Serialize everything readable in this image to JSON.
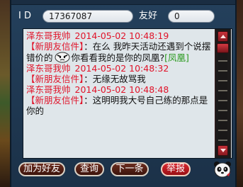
{
  "header": {
    "id_label": "I D",
    "id_value": "17367087",
    "friend_label": "友好",
    "friend_value": "0"
  },
  "messages": [
    {
      "sender": "泽东哥我帅",
      "time": "2014-05-02 10:48:19",
      "tag": "【新朋友信件】",
      "text_before_emoji": "：在么 我昨天活动还遇到个说摆错价的",
      "text_after_emoji": "你看看我的是你的凤凰?",
      "suffix": "[凤凰]",
      "emoji_icon": "face-emoji-icon"
    },
    {
      "sender": "泽东哥我帅",
      "time": "2014-05-02 10:48:32",
      "tag": "【新朋友信件】",
      "text": "：无缘无故骂我"
    },
    {
      "sender": "泽东哥我帅",
      "time": "2014-05-02 10:48:48",
      "tag": "【新朋友信件】",
      "text": "：这明明我大号自己练的那点是你的"
    }
  ],
  "buttons": {
    "add_friend": "加为好友",
    "inspect": "查询",
    "next": "下一条",
    "report": "举报"
  },
  "icons": {
    "panda": "panda-icon",
    "scroll_up": "scroll-up-icon",
    "scroll_down": "scroll-down-icon"
  },
  "colors": {
    "sender_red": "#e0142a",
    "tag_green": "#2a9a1e",
    "panel_blue": "#1b3148",
    "report_red": "#d8262e"
  }
}
